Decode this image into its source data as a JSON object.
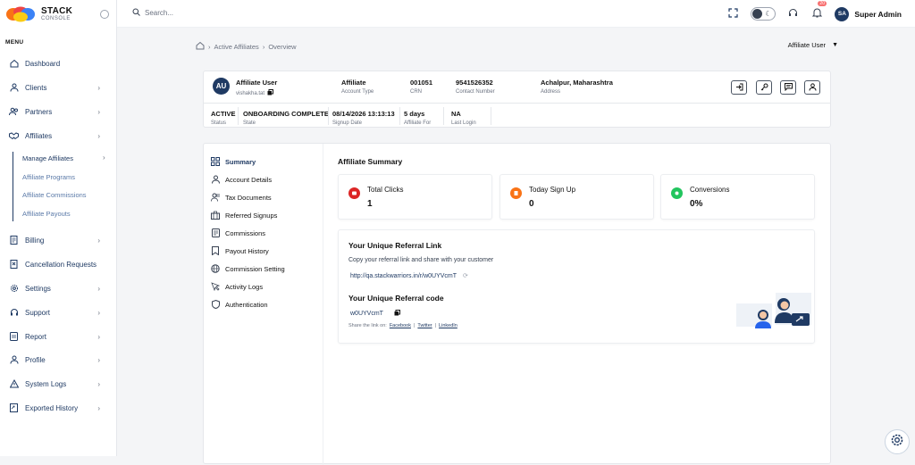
{
  "brand": {
    "name": "STACK",
    "sub": "CONSOLE"
  },
  "menu_title": "MENU",
  "nav": [
    {
      "label": "Dashboard",
      "icon": "home-icon",
      "chevron": false
    },
    {
      "label": "Clients",
      "icon": "user-icon",
      "chevron": true
    },
    {
      "label": "Partners",
      "icon": "users-icon",
      "chevron": true
    },
    {
      "label": "Affiliates",
      "icon": "handshake-icon",
      "chevron": true
    },
    {
      "label": "Billing",
      "icon": "document-icon",
      "chevron": true
    },
    {
      "label": "Cancellation Requests",
      "icon": "cancel-doc-icon",
      "chevron": false
    },
    {
      "label": "Settings",
      "icon": "gear-icon",
      "chevron": true
    },
    {
      "label": "Support",
      "icon": "headset-icon",
      "chevron": true
    },
    {
      "label": "Report",
      "icon": "report-icon",
      "chevron": true
    },
    {
      "label": "Profile",
      "icon": "profile-icon",
      "chevron": true
    },
    {
      "label": "System Logs",
      "icon": "warning-icon",
      "chevron": true
    },
    {
      "label": "Exported History",
      "icon": "export-icon",
      "chevron": true
    }
  ],
  "affiliate_sub": [
    "Manage Affiliates",
    "Affiliate Programs",
    "Affiliate Commissions",
    "Affiliate Payouts"
  ],
  "topbar": {
    "search_placeholder": "Search...",
    "notif_count": "20",
    "user_initials": "SA",
    "user_name": "Super Admin"
  },
  "breadcrumb": [
    "Active Affiliates",
    "Overview"
  ],
  "user_select": "Affiliate User",
  "header": {
    "initials": "AU",
    "name": "Affiliate User",
    "username": "vishakha.tat",
    "account_type_value": "Affiliate",
    "account_type_label": "Account Type",
    "crn_value": "001051",
    "crn_label": "CRN",
    "contact_value": "9541526352",
    "contact_label": "Contact Number",
    "address_value": "Achalpur, Maharashtra",
    "address_label": "Address",
    "status_value": "ACTIVE",
    "status_label": "Status",
    "state_value": "ONBOARDING COMPLETE",
    "state_label": "State",
    "signup_value": "08/14/2026 13:13:13",
    "signup_label": "Signup Date",
    "affiliate_for_value": "5 days",
    "affiliate_for_label": "Affiliate For",
    "last_login_value": "NA",
    "last_login_label": "Last Login"
  },
  "tabs": [
    {
      "label": "Summary",
      "icon": "grid-icon"
    },
    {
      "label": "Account Details",
      "icon": "user-icon"
    },
    {
      "label": "Tax Documents",
      "icon": "user-doc-icon"
    },
    {
      "label": "Referred Signups",
      "icon": "briefcase-icon"
    },
    {
      "label": "Commissions",
      "icon": "receipt-icon"
    },
    {
      "label": "Payout History",
      "icon": "bookmark-icon"
    },
    {
      "label": "Commission Setting",
      "icon": "globe-icon"
    },
    {
      "label": "Activity Logs",
      "icon": "pointer-icon"
    },
    {
      "label": "Authentication",
      "icon": "shield-icon"
    }
  ],
  "summary": {
    "title": "Affiliate Summary",
    "stats": [
      {
        "label": "Total Clicks",
        "value": "1",
        "color": "#dc2626"
      },
      {
        "label": "Today Sign Up",
        "value": "0",
        "color": "#f97316"
      },
      {
        "label": "Conversions",
        "value": "0%",
        "color": "#22c55e"
      }
    ],
    "ref_link_title": "Your Unique Referral Link",
    "ref_link_desc": "Copy your referral link and share with your customer",
    "ref_link": "http://qa.stackwarriors.in/r/w0UYVcmT",
    "ref_code_title": "Your Unique Referral code",
    "ref_code": "w0UYVcmT",
    "share_prefix": "Share the link on:",
    "share_links": [
      "Facebook",
      "Twitter",
      "LinkedIn"
    ]
  }
}
